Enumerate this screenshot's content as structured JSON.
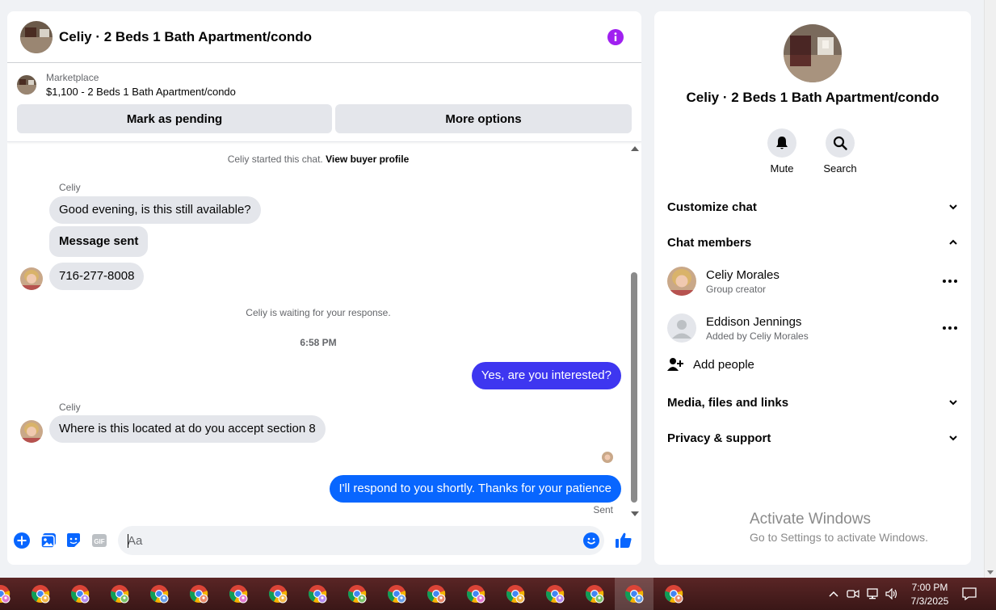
{
  "chat": {
    "header_title": "Celiy · 2 Beds 1 Bath Apartment/condo",
    "marketplace_label": "Marketplace",
    "listing_title": "$1,100 - 2 Beds 1 Bath Apartment/condo",
    "mark_pending_label": "Mark as pending",
    "more_options_label": "More options",
    "started_text": "Celiy started this chat.",
    "buyer_profile_link": "View buyer profile",
    "messages": [
      {
        "sender": "Celiy",
        "text": "Good evening, is this still available?"
      },
      {
        "text": "Message sent"
      },
      {
        "text": "716-277-8008"
      }
    ],
    "waiting_text": "Celiy is waiting for your response.",
    "timestamp": "6:58 PM",
    "outgoing_1": "Yes, are you interested?",
    "incoming_2_sender": "Celiy",
    "incoming_2": "Where is this located at do you accept section 8",
    "outgoing_2": "I'll respond to you shortly. Thanks for your patience",
    "sent_status": "Sent",
    "composer_placeholder": "Aa"
  },
  "details": {
    "title": "Celiy · 2 Beds 1 Bath Apartment/condo",
    "mute_label": "Mute",
    "search_label": "Search",
    "customize_chat": "Customize chat",
    "chat_members": "Chat members",
    "members": [
      {
        "name": "Celiy Morales",
        "role": "Group creator"
      },
      {
        "name": "Eddison Jennings",
        "role": "Added by Celiy Morales"
      }
    ],
    "add_people": "Add people",
    "media_files_links": "Media, files and links",
    "privacy_support": "Privacy & support"
  },
  "watermark": {
    "title": "Activate Windows",
    "subtitle": "Go to Settings to activate Windows."
  },
  "taskbar": {
    "time": "7:00 PM",
    "date": "7/3/2025",
    "app_count": 18
  },
  "colors": {
    "accent_blue": "#0866ff",
    "info_purple": "#a020f0",
    "outgoing_first": "#3e36f0"
  }
}
